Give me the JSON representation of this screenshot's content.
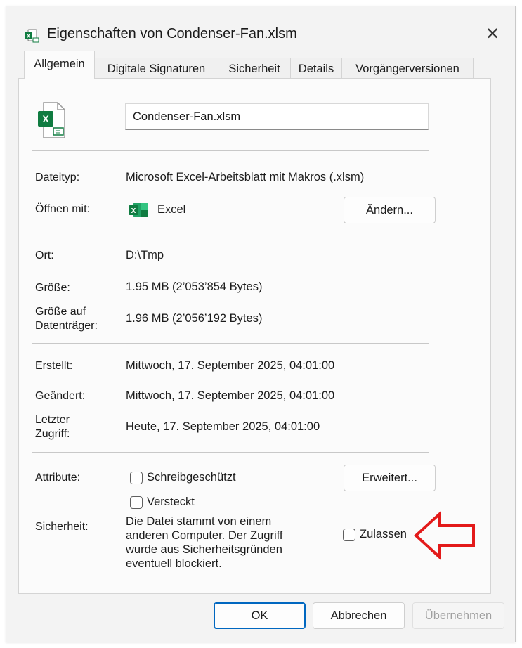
{
  "window": {
    "title": "Eigenschaften von Condenser-Fan.xlsm",
    "close_glyph": "✕"
  },
  "tabs": [
    {
      "label": "Allgemein",
      "active": true
    },
    {
      "label": "Digitale Signaturen"
    },
    {
      "label": "Sicherheit"
    },
    {
      "label": "Details"
    },
    {
      "label": "Vorgängerversionen"
    }
  ],
  "file": {
    "name": "Condenser-Fan.xlsm",
    "icon": "excel-file-icon"
  },
  "info": {
    "dateityp_label": "Dateityp:",
    "dateityp_value": "Microsoft Excel-Arbeitsblatt mit Makros (.xlsm)",
    "oeffnen_label": "Öffnen mit:",
    "oeffnen_value": "Excel",
    "aendern_button": "Ändern...",
    "ort_label": "Ort:",
    "ort_value": "D:\\Tmp",
    "groesse_label": "Größe:",
    "groesse_value": "1.95 MB (2’053’854 Bytes)",
    "groesse_auf_label_1": "Größe auf",
    "groesse_auf_label_2": "Datenträger:",
    "groesse_auf_value": "1.96 MB (2’056’192 Bytes)",
    "erstellt_label": "Erstellt:",
    "erstellt_value": "Mittwoch, 17. September 2025, 04:01:00",
    "geaendert_label": "Geändert:",
    "geaendert_value": "Mittwoch, 17. September 2025, 04:01:00",
    "zugriff_label_1": "Letzter",
    "zugriff_label_2": "Zugriff:",
    "zugriff_value": "Heute, 17. September 2025, 04:01:00"
  },
  "attributes": {
    "label": "Attribute:",
    "readonly": "Schreibgeschützt",
    "hidden": "Versteckt",
    "advanced_button": "Erweitert..."
  },
  "security": {
    "label": "Sicherheit:",
    "line1": "Die Datei stammt von einem",
    "line2": "anderen Computer. Der Zugriff",
    "line3": "wurde aus Sicherheitsgründen",
    "line4": "eventuell blockiert.",
    "allow": "Zulassen"
  },
  "footer": {
    "ok": "OK",
    "cancel": "Abbrechen",
    "apply": "Übernehmen"
  },
  "colors": {
    "accent": "#0067c0",
    "excel_green": "#107c41",
    "annotation_red": "#e31a1a"
  }
}
